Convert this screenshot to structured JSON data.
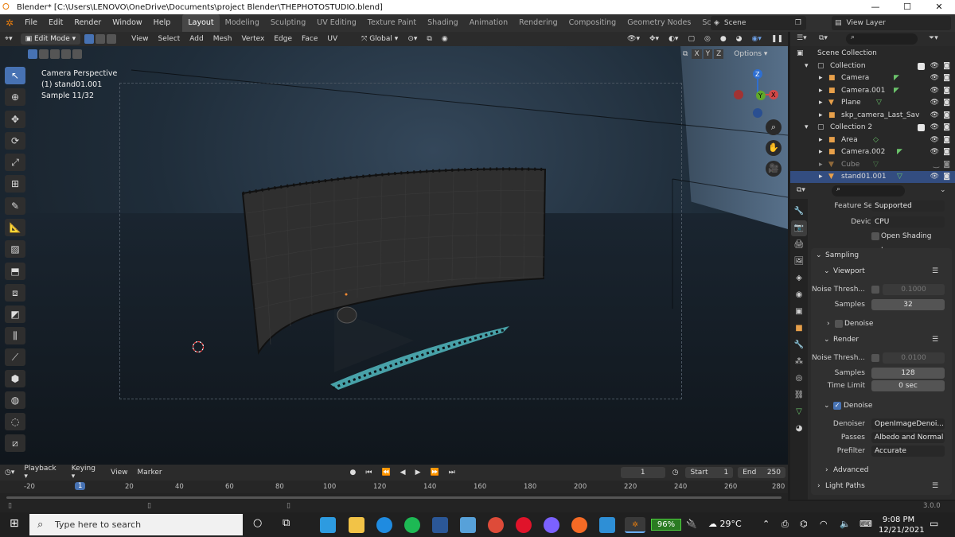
{
  "window": {
    "logo": "⭘",
    "title": "Blender* [C:\\Users\\LENOVO\\OneDrive\\Documents\\project Blender\\THEPHOTOSTUDIO.blend]",
    "controls": [
      "—",
      "☐",
      "✕"
    ]
  },
  "menu": [
    "File",
    "Edit",
    "Render",
    "Window",
    "Help"
  ],
  "workspaces": [
    "Layout",
    "Modeling",
    "Sculpting",
    "UV Editing",
    "Texture Paint",
    "Shading",
    "Animation",
    "Rendering",
    "Compositing",
    "Geometry Nodes",
    "Scripting",
    "+"
  ],
  "scene_label": "Scene",
  "view_layer_label": "View Layer",
  "viewport_header": {
    "mode": "Edit Mode",
    "menus": [
      "View",
      "Select",
      "Add",
      "Mesh",
      "Vertex",
      "Edge",
      "Face",
      "UV"
    ],
    "transform": "Global",
    "options": "Options",
    "axes": [
      "X",
      "Y",
      "Z"
    ]
  },
  "viewport_info": {
    "line1": "Camera Perspective",
    "line2": "(1) stand01.001",
    "line3": "Sample 11/32"
  },
  "gizmo": {
    "x": "X",
    "y": "Y",
    "z": "Z"
  },
  "timeline": {
    "menus": [
      "Playback",
      "Keying",
      "View",
      "Marker"
    ],
    "current_frame": "1",
    "start_label": "Start",
    "start": "1",
    "end_label": "End",
    "end": "250",
    "ruler": [
      "-20",
      "1",
      "20",
      "40",
      "60",
      "80",
      "100",
      "120",
      "140",
      "160",
      "180",
      "200",
      "220",
      "240",
      "260",
      "280"
    ]
  },
  "outliner": {
    "rows": [
      {
        "label": "Scene Collection",
        "type": "root"
      },
      {
        "label": "Collection",
        "type": "collection"
      },
      {
        "label": "Camera",
        "type": "object"
      },
      {
        "label": "Camera.001",
        "type": "object"
      },
      {
        "label": "Plane",
        "type": "object"
      },
      {
        "label": "skp_camera_Last_Sav",
        "type": "object"
      },
      {
        "label": "Collection 2",
        "type": "collection"
      },
      {
        "label": "Area",
        "type": "object"
      },
      {
        "label": "Camera.002",
        "type": "object"
      },
      {
        "label": "Cube",
        "type": "object"
      },
      {
        "label": "stand01.001",
        "type": "object",
        "selected": true
      }
    ]
  },
  "properties": {
    "feature_set_label": "Feature Set",
    "feature_set": "Supported",
    "device_label": "Device",
    "device": "CPU",
    "osl": "Open Shading Lang...",
    "sampling": "Sampling",
    "viewport": "Viewport",
    "noise_label": "Noise Thresh...",
    "viewport_noise": "0.1000",
    "samples_label": "Samples",
    "viewport_samples": "32",
    "denoise": "Denoise",
    "render": "Render",
    "render_noise": "0.0100",
    "render_samples": "128",
    "time_limit_label": "Time Limit",
    "time_limit": "0 sec",
    "denoiser_label": "Denoiser",
    "denoiser": "OpenImageDenoi...",
    "passes_label": "Passes",
    "passes": "Albedo and Normal",
    "prefilter_label": "Prefilter",
    "prefilter": "Accurate",
    "advanced": "Advanced",
    "light_paths": "Light Paths"
  },
  "version": "3.0.0",
  "taskbar": {
    "search_placeholder": "Type here to search",
    "battery": "96%",
    "weather": "29°C",
    "time": "9:08 PM",
    "date": "12/21/2021"
  },
  "colors": {
    "accent": "#4772b3",
    "selected_row": "#334d80",
    "blender_orange": "#e87d0d"
  }
}
